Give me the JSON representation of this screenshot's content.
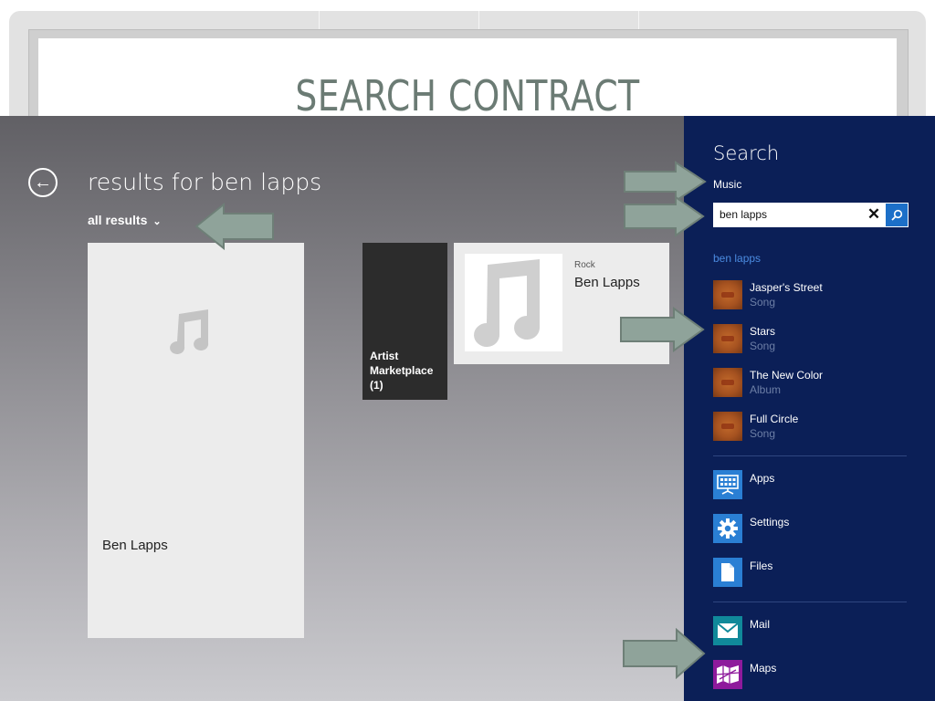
{
  "slide": {
    "title": "SEARCH CONTRACT"
  },
  "app": {
    "results_title": "results for ben lapps",
    "filter_label": "all results",
    "large_tile": {
      "name": "Ben Lapps",
      "icon": "music-note-icon"
    },
    "group_tile": {
      "line1": "Artist",
      "line2": "Marketplace",
      "line3": "(1)"
    },
    "artist_tile": {
      "genre": "Rock",
      "name": "Ben Lapps",
      "icon": "music-note-icon"
    }
  },
  "search_pane": {
    "title": "Search",
    "scope": "Music",
    "query_value": "ben lapps",
    "clear_glyph": "✕",
    "suggestions_header": "ben lapps",
    "suggestions": [
      {
        "title": "Jasper's Street",
        "type": "Song"
      },
      {
        "title": "Stars",
        "type": "Song"
      },
      {
        "title": "The New Color",
        "type": "Album"
      },
      {
        "title": "Full Circle",
        "type": "Song"
      }
    ],
    "system_items": [
      {
        "label": "Apps",
        "icon": "apps-icon",
        "color": "#2a7fd4"
      },
      {
        "label": "Settings",
        "icon": "gear-icon",
        "color": "#2a7fd4"
      },
      {
        "label": "Files",
        "icon": "file-icon",
        "color": "#2a7fd4"
      }
    ],
    "app_items": [
      {
        "label": "Mail",
        "icon": "mail-icon",
        "color": "#10899a"
      },
      {
        "label": "Maps",
        "icon": "map-icon",
        "color": "#8e1a9c"
      }
    ]
  },
  "colors": {
    "pane_bg": "#0b1f57",
    "accent_blue": "#1c6fc8",
    "arrow_fill": "#8fa39a"
  }
}
